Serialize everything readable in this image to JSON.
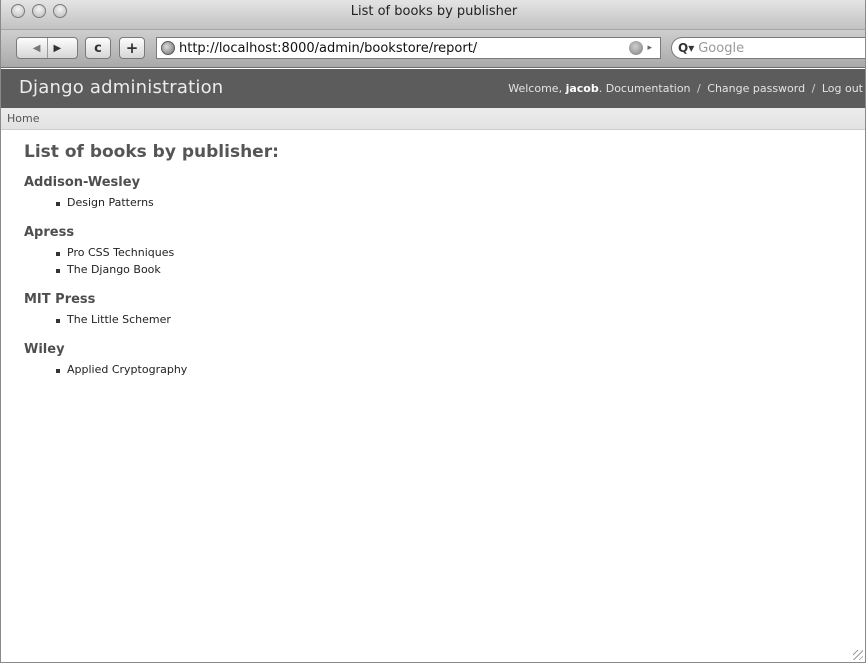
{
  "window": {
    "title": "List of books by publisher"
  },
  "toolbar": {
    "back_icon": "◀",
    "forward_icon": "▶",
    "reload_icon": "c",
    "add_icon": "+",
    "url": "http://localhost:8000/admin/bookstore/report/",
    "search_placeholder": "Google",
    "search_glyph": "Q▾"
  },
  "header": {
    "site_title": "Django administration",
    "welcome": "Welcome,",
    "user": "jacob",
    "period": ".",
    "links": [
      "Documentation",
      "Change password",
      "Log out"
    ],
    "separator": "/"
  },
  "breadcrumb": {
    "home": "Home"
  },
  "content": {
    "heading": "List of books by publisher:",
    "publishers": [
      {
        "name": "Addison-Wesley",
        "books": [
          "Design Patterns"
        ]
      },
      {
        "name": "Apress",
        "books": [
          "Pro CSS Techniques",
          "The Django Book"
        ]
      },
      {
        "name": "MIT Press",
        "books": [
          "The Little Schemer"
        ]
      },
      {
        "name": "Wiley",
        "books": [
          "Applied Cryptography"
        ]
      }
    ]
  },
  "icons": [
    "back-icon",
    "forward-icon",
    "reload-icon",
    "add-bookmark-icon",
    "globe-icon",
    "snapback-icon",
    "search-icon",
    "resize-grip-icon"
  ]
}
